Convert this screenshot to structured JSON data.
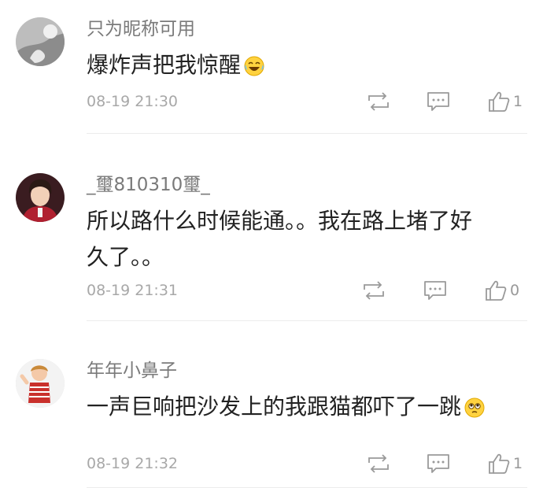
{
  "comments": [
    {
      "username": "只为昵称可用",
      "text": "爆炸声把我惊醒",
      "emoji": "crying-laughing-emoji",
      "time": "08-19 21:30",
      "like_count": "1"
    },
    {
      "username": "_璽810310璽_",
      "text_line1": "所以路什么时候能通。。我在路上堵了好",
      "text_line2": "久了。。",
      "time": "08-19 21:31",
      "like_count": "0"
    },
    {
      "username": "年年小鼻子",
      "text": "一声巨响把沙发上的我跟猫都吓了一跳",
      "emoji": "pleading-face-emoji",
      "time": "08-19 21:32",
      "like_count": "1"
    }
  ],
  "icons": {
    "repost": "repost-icon",
    "comment": "comment-icon",
    "like": "thumbs-up-icon"
  },
  "colors": {
    "username": "#7a7a7a",
    "text": "#222222",
    "meta": "#a8a8a8",
    "icon": "#9a9a9a",
    "divider": "#ececec"
  }
}
